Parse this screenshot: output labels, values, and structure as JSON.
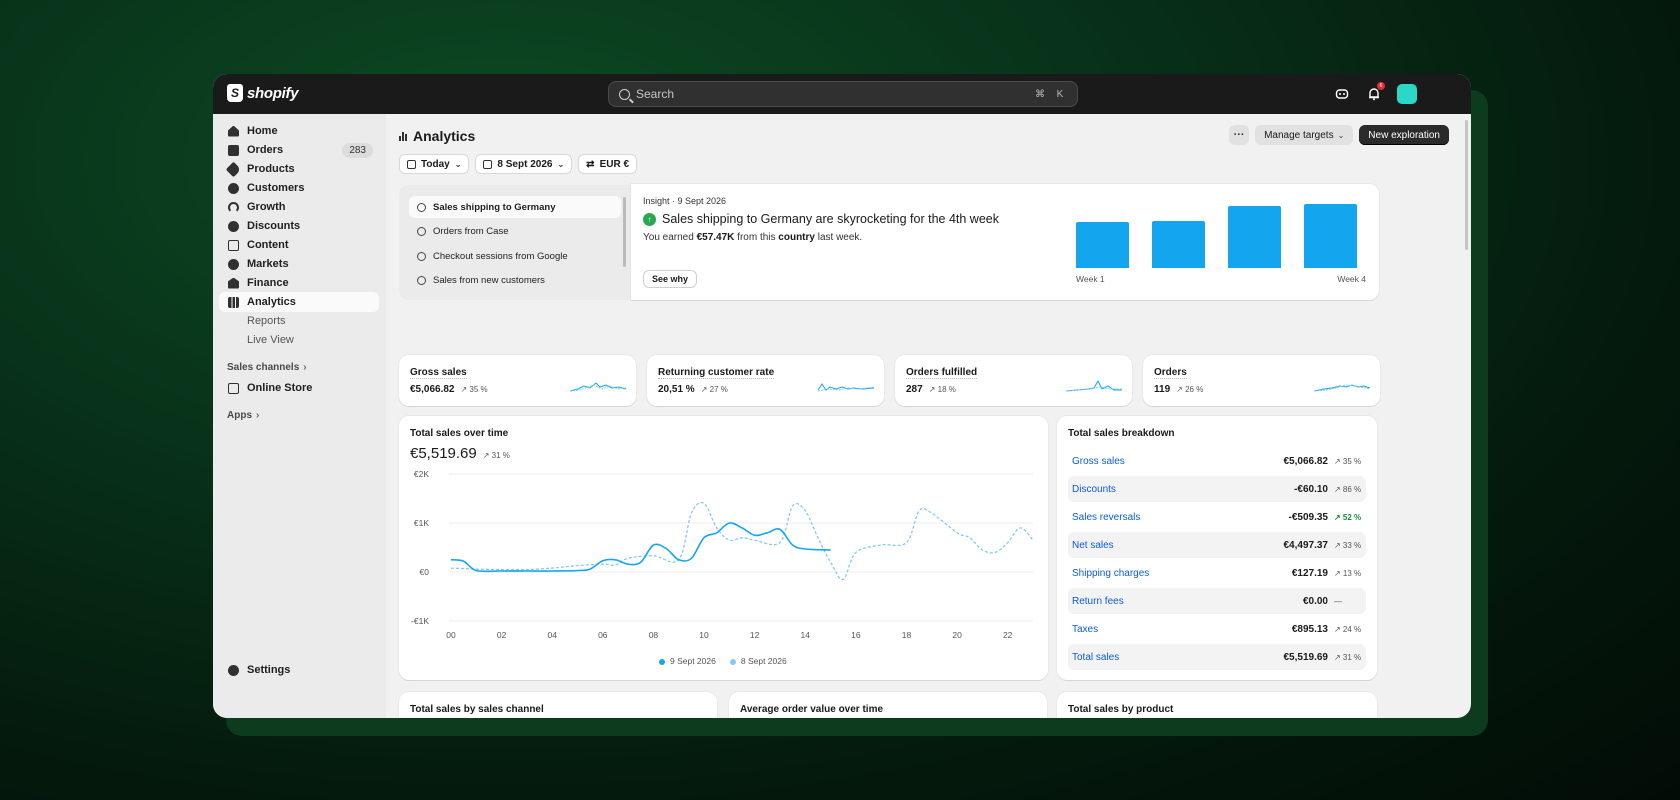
{
  "brand": {
    "logo_text": "shopify"
  },
  "search": {
    "placeholder": "Search",
    "shortcut_mod": "⌘",
    "shortcut_key": "K"
  },
  "topbar": {
    "notification_count": "6"
  },
  "sidebar": {
    "items": [
      {
        "label": "Home",
        "icon": "home-icon"
      },
      {
        "label": "Orders",
        "icon": "orders-icon",
        "count": "283"
      },
      {
        "label": "Products",
        "icon": "tag-icon"
      },
      {
        "label": "Customers",
        "icon": "person-icon"
      },
      {
        "label": "Growth",
        "icon": "growth-icon"
      },
      {
        "label": "Discounts",
        "icon": "discount-icon"
      },
      {
        "label": "Content",
        "icon": "content-icon"
      },
      {
        "label": "Markets",
        "icon": "globe-icon"
      },
      {
        "label": "Finance",
        "icon": "bank-icon"
      },
      {
        "label": "Analytics",
        "icon": "analytics-icon"
      }
    ],
    "sub_items": [
      "Reports",
      "Live View"
    ],
    "sales_channels_heading": "Sales channels",
    "online_store": "Online Store",
    "apps_heading": "Apps",
    "settings": "Settings"
  },
  "header": {
    "title": "Analytics",
    "more_label": "···",
    "manage_targets": "Manage targets",
    "new_exploration": "New exploration"
  },
  "filters": {
    "date_range": "Today",
    "compare_date": "8 Sept 2026",
    "currency": "EUR €"
  },
  "insights": {
    "list": [
      "Sales shipping to Germany",
      "Orders from Case",
      "Checkout sessions from Google",
      "Sales from new customers"
    ],
    "meta": "Insight · 9 Sept 2026",
    "title": "Sales shipping to Germany are skyrocketing for the 4th week",
    "body_prefix": "You earned ",
    "body_amount": "€57.47K",
    "body_mid": " from this ",
    "body_emph": "country",
    "body_suffix": " last week.",
    "see_why": "See why",
    "bars": [
      0.72,
      0.74,
      0.97,
      1.0
    ],
    "bar_axis_start": "Week 1",
    "bar_axis_end": "Week 4"
  },
  "kpis": [
    {
      "label": "Gross sales",
      "value": "€5,066.82",
      "change": "↗ 35 %"
    },
    {
      "label": "Returning customer rate",
      "value": "20,51 %",
      "change": "↗ 27 %"
    },
    {
      "label": "Orders fulfilled",
      "value": "287",
      "change": "↗ 18 %"
    },
    {
      "label": "Orders",
      "value": "119",
      "change": "↗ 26 %"
    }
  ],
  "total_sales": {
    "title": "Total sales over time",
    "value": "€5,519.69",
    "change": "↗ 31 %"
  },
  "chart_data": {
    "type": "line",
    "y_ticks": [
      "€2K",
      "€1K",
      "€0",
      "-€1K"
    ],
    "ylim": [
      -1000,
      2000
    ],
    "x_ticks": [
      "00",
      "02",
      "04",
      "06",
      "08",
      "10",
      "12",
      "14",
      "16",
      "18",
      "20",
      "22"
    ],
    "series": [
      {
        "name": "9 Sept 2026",
        "color": "#13a6ef",
        "style": "solid",
        "x": [
          0,
          0.5,
          1,
          2,
          3,
          4,
          5,
          5.5,
          6,
          6.5,
          7,
          7.5,
          8,
          8.5,
          9,
          9.5,
          10,
          10.5,
          11,
          11.5,
          12,
          12.5,
          13,
          13.5,
          14,
          15
        ],
        "y": [
          250,
          220,
          30,
          20,
          20,
          20,
          30,
          60,
          230,
          250,
          160,
          200,
          550,
          480,
          250,
          280,
          700,
          800,
          1000,
          900,
          750,
          800,
          870,
          550,
          470,
          450
        ]
      },
      {
        "name": "8 Sept 2026",
        "color": "#86c9f5",
        "style": "dashed",
        "x": [
          0,
          0.5,
          1,
          2,
          3,
          4,
          5,
          6,
          6.5,
          7,
          8,
          9,
          9.5,
          10,
          10.5,
          11,
          11.5,
          12,
          13,
          13.5,
          14,
          14.5,
          15,
          15.5,
          16,
          17,
          18,
          18.5,
          19,
          20,
          20.5,
          21,
          21.5,
          22,
          22.5,
          23
        ],
        "y": [
          80,
          70,
          60,
          50,
          50,
          80,
          130,
          160,
          140,
          280,
          330,
          250,
          1200,
          1400,
          900,
          650,
          700,
          650,
          600,
          1350,
          1250,
          700,
          200,
          -150,
          400,
          550,
          600,
          1250,
          1200,
          800,
          700,
          450,
          400,
          600,
          900,
          650
        ]
      }
    ]
  },
  "breakdown": {
    "title": "Total sales breakdown",
    "rows": [
      {
        "label": "Gross sales",
        "value": "€5,066.82",
        "change": "↗ 35 %"
      },
      {
        "label": "Discounts",
        "value": "-€60.10",
        "change": "↗ 86 %"
      },
      {
        "label": "Sales reversals",
        "value": "-€509.35",
        "change": "↗ 52 %",
        "positive": true
      },
      {
        "label": "Net sales",
        "value": "€4,497.37",
        "change": "↗ 33 %"
      },
      {
        "label": "Shipping charges",
        "value": "€127.19",
        "change": "↗ 13 %"
      },
      {
        "label": "Return fees",
        "value": "€0.00",
        "change": "—"
      },
      {
        "label": "Taxes",
        "value": "€895.13",
        "change": "↗ 24 %"
      },
      {
        "label": "Total sales",
        "value": "€5,519.69",
        "change": "↗ 31 %"
      }
    ]
  },
  "bottom_cards": [
    "Total sales by sales channel",
    "Average order value over time",
    "Total sales by product"
  ],
  "colors": {
    "accent": "#13a6ef",
    "accent_light": "#86c9f5",
    "link": "#0b5cd6",
    "positive": "#1a8d3c"
  }
}
